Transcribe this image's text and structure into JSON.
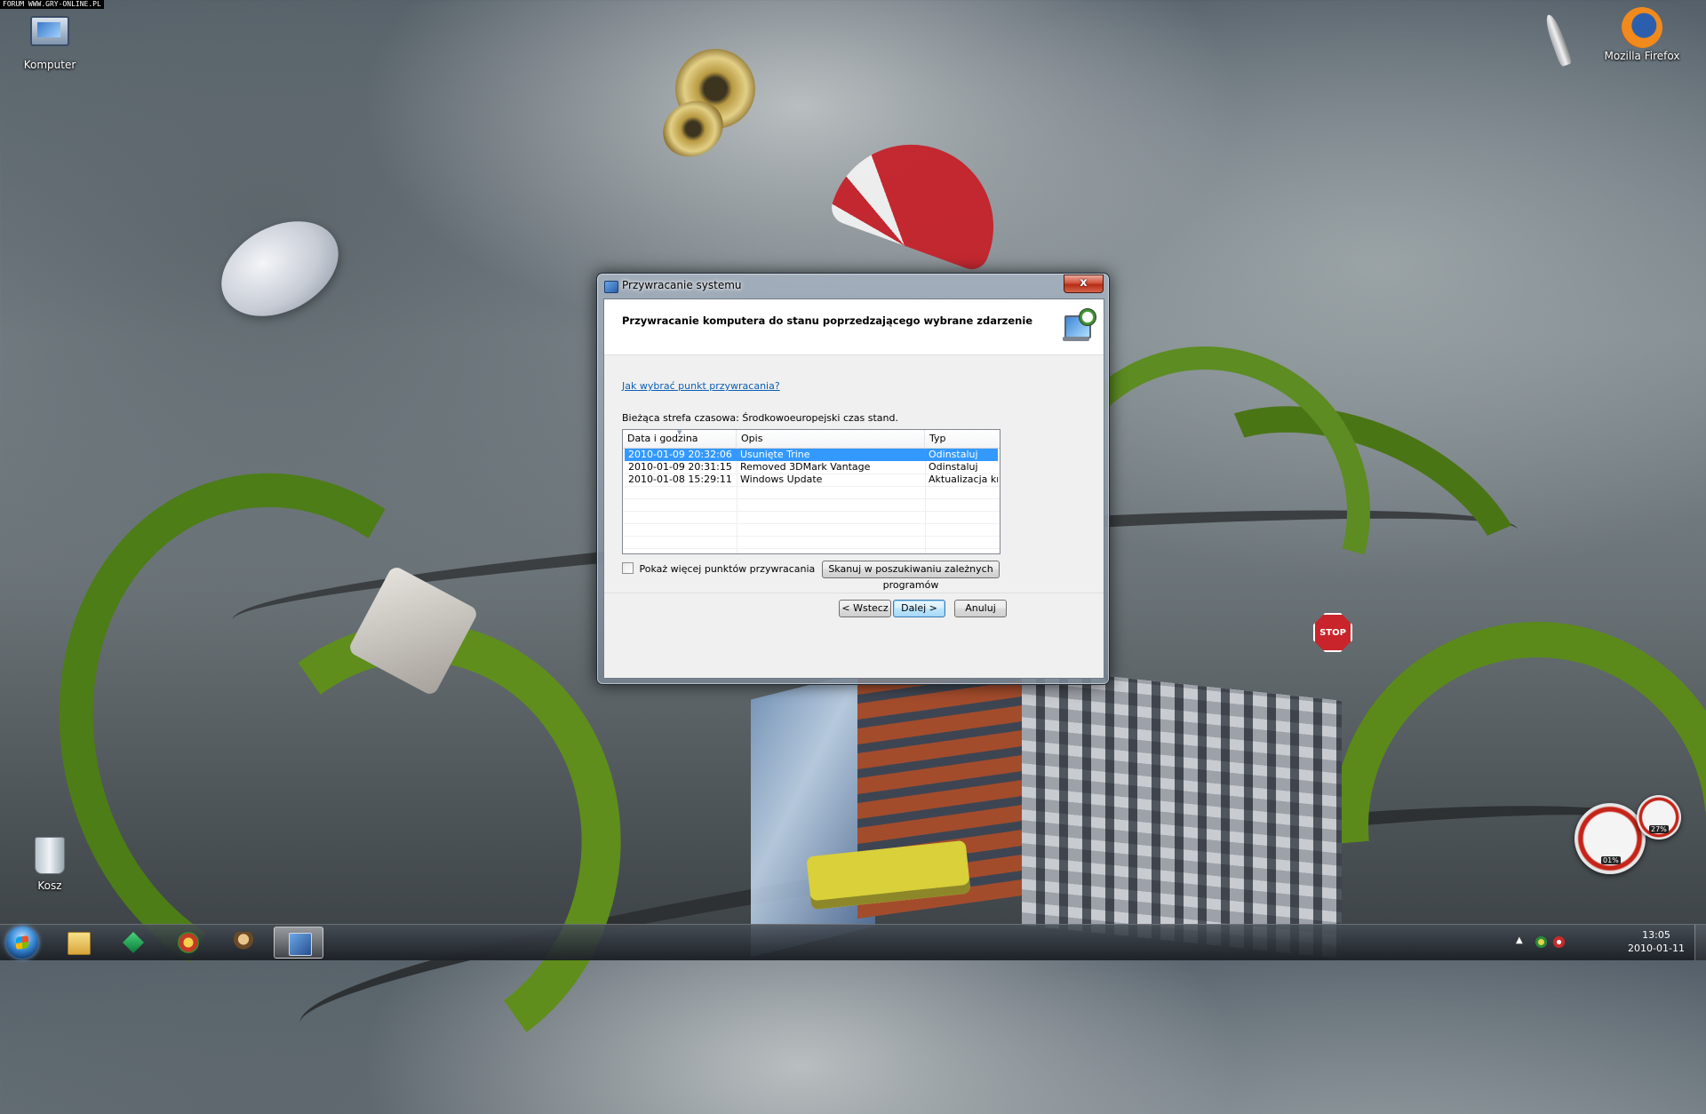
{
  "watermark": "FORUM WWW.GRY-ONLINE.PL",
  "desktop": {
    "icons": [
      {
        "label": "Komputer",
        "icon": "computer-icon"
      },
      {
        "label": "Mozilla Firefox",
        "icon": "firefox-icon"
      },
      {
        "label": "Kosz",
        "icon": "recycle-bin-icon"
      }
    ]
  },
  "dialog": {
    "window_title": "Przywracanie systemu",
    "close_label": "x",
    "header_title": "Przywracanie komputera do stanu poprzedzającego wybrane zdarzenie",
    "help_link": "Jak wybrać punkt przywracania?",
    "timezone_text": "Bieżąca strefa czasowa: Środkowoeuropejski czas stand.",
    "columns": [
      "Data i godzina",
      "Opis",
      "Typ"
    ],
    "sorted_column": "Data i godzina",
    "rows": [
      {
        "date": "2010-01-09 20:32:06",
        "description": "Usunięte Trine",
        "type": "Odinstaluj",
        "selected": true
      },
      {
        "date": "2010-01-09 20:31:15",
        "description": "Removed 3DMark Vantage",
        "type": "Odinstaluj",
        "selected": false
      },
      {
        "date": "2010-01-08 15:29:11",
        "description": "Windows Update",
        "type": "Aktualizacja kryt…",
        "selected": false
      }
    ],
    "show_more_label": "Pokaż więcej punktów przywracania",
    "show_more_checked": false,
    "scan_button": "Skanuj w poszukiwaniu zależnych programów",
    "back_button": "< Wstecz",
    "next_button": "Dalej >",
    "cancel_button": "Anuluj"
  },
  "gadget": {
    "cpu_label": "01%",
    "memory_label": "27%"
  },
  "taskbar": {
    "pinned": [
      "folder-icon",
      "sims-icon",
      "game-icon",
      "character-icon",
      "system-restore-icon"
    ],
    "active_item": "system-restore-icon",
    "clock_time": "13:05",
    "clock_date": "2010-01-11"
  },
  "colors": {
    "selection": "#3399ff",
    "link": "#0b5fb5",
    "close_button": "#c8432a"
  }
}
